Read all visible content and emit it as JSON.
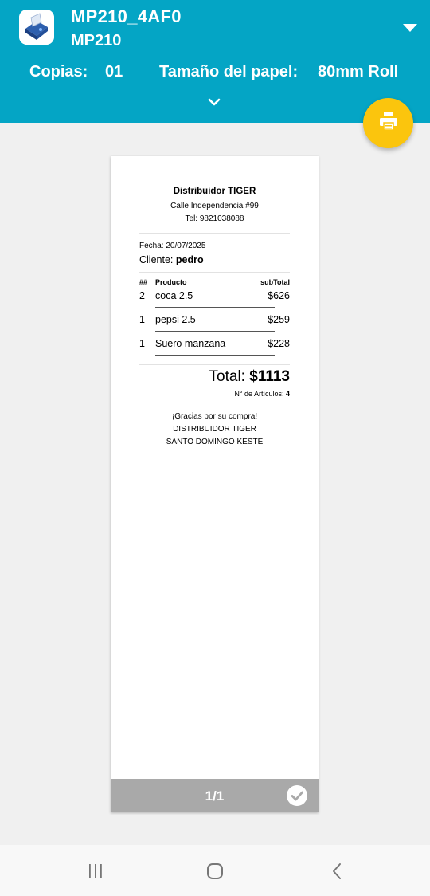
{
  "header": {
    "printer_name": "MP210_4AF0",
    "printer_model": "MP210",
    "copies_label": "Copias:",
    "copies_value": "01",
    "paper_label": "Tamaño del papel:",
    "paper_value": "80mm Roll"
  },
  "receipt": {
    "store_name": "Distribuidor TIGER",
    "address": "Calle Independencia #99",
    "phone": "Tel: 9821038088",
    "date": "Fecha: 20/07/2025",
    "client_label": "Cliente: ",
    "client_name": "pedro",
    "columns": {
      "qty": "##",
      "product": "Producto",
      "subtotal": "subTotal"
    },
    "items": [
      {
        "qty": "2",
        "product": "coca 2.5",
        "subtotal": "$626"
      },
      {
        "qty": "1",
        "product": "pepsi 2.5",
        "subtotal": "$259"
      },
      {
        "qty": "1",
        "product": "Suero manzana",
        "subtotal": "$228"
      }
    ],
    "total_label": "Total: ",
    "total_value": "$1113",
    "count_label": "N° de Artículos: ",
    "count_value": "4",
    "footer_lines": [
      "¡Gracias por su compra!",
      "DISTRIBUIDOR TIGER",
      "SANTO DOMINGO KESTE"
    ]
  },
  "pager": {
    "page_indicator": "1/1"
  },
  "colors": {
    "header": "#04a5c5",
    "fab": "#fbc50d",
    "page_bar": "#a9a9a9"
  },
  "icons": {
    "app": "printer-app-icon",
    "dropdown": "dropdown-triangle-icon",
    "expand": "chevron-down-icon",
    "fab": "print-icon",
    "check": "check-circle-icon",
    "nav": [
      "recent-apps-icon",
      "home-icon",
      "back-icon"
    ]
  }
}
